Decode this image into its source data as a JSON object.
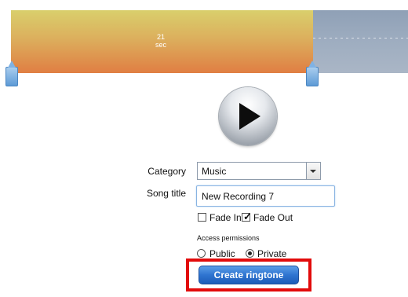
{
  "trimmer": {
    "duration_value": "21",
    "duration_unit": "sec",
    "colors": {
      "selected_top": "#d9cf6c",
      "selected_bottom": "#e07e43",
      "unselected": "#9eadc0",
      "handle": "#5d9ad6"
    }
  },
  "player": {
    "play_icon": "play-icon"
  },
  "form": {
    "category_label": "Category",
    "category_value": "Music",
    "song_title_label": "Song title",
    "song_title_value": "New Recording 7",
    "fade_in_label": "Fade In",
    "fade_in_checked": false,
    "fade_out_label": "Fade Out",
    "fade_out_checked": true,
    "access_permissions_label": "Access permissions",
    "public_label": "Public",
    "private_label": "Private",
    "selected_permission": "Private"
  },
  "actions": {
    "create_label": "Create ringtone",
    "highlight_color": "#e20b0b",
    "button_color": "#2f74d0"
  }
}
